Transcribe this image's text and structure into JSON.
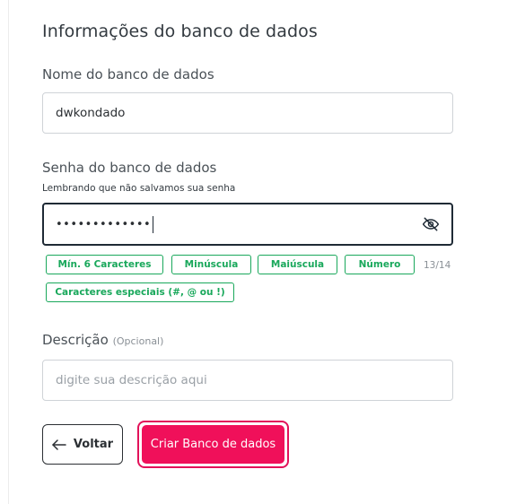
{
  "form": {
    "title": "Informações do banco de dados",
    "db_name": {
      "label": "Nome do banco de dados",
      "value": "dwkondado"
    },
    "db_password": {
      "label": "Senha do banco de dados",
      "hint": "Lembrando que não salvamos sua senha",
      "masked_value": "•••••••••••••",
      "visibility_icon": "eye-slash-icon"
    },
    "password_rules": {
      "chips": [
        "Mín. 6 Caracteres",
        "Minúscula",
        "Maiúscula",
        "Número",
        "Caracteres especiais (#, @ ou !)"
      ],
      "counter": "13/14",
      "chip_color": "#19a85b"
    },
    "description": {
      "label": "Descrição",
      "optional_tag": "(Opcional)",
      "placeholder": "digite sua descrição aqui",
      "value": ""
    }
  },
  "actions": {
    "back_label": "Voltar",
    "back_icon": "arrow-left-icon",
    "create_label": "Criar Banco de dados",
    "create_color": "#f0105a"
  }
}
